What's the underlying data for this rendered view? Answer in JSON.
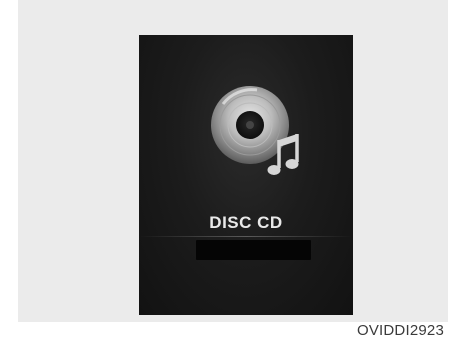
{
  "screen": {
    "status_label": "DISC CD",
    "icon": "cd-disc-music-icon",
    "info_text": ""
  },
  "figure": {
    "caption": "OVIDDI2923"
  },
  "colors": {
    "screen_background": "#1c1c1c",
    "label_text": "#e9e9e9",
    "page_background": "#ebebeb"
  }
}
